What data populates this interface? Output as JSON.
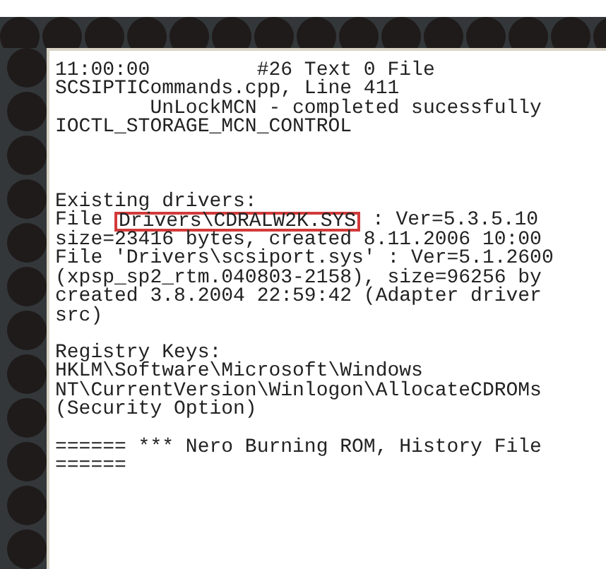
{
  "log": {
    "paragraphs": [
      {
        "lines": [
          {
            "kind": "plain",
            "text": "11:00:00         #26 Text 0 File"
          },
          {
            "kind": "plain",
            "text": "SCSIPTICommands.cpp, Line 411"
          },
          {
            "kind": "plain",
            "text": "        UnLockMCN - completed sucessfully"
          },
          {
            "kind": "plain",
            "text": "IOCTL_STORAGE_MCN_CONTROL"
          }
        ]
      },
      {
        "lines": [
          {
            "kind": "plain",
            "text": "Existing drivers:"
          },
          {
            "kind": "highlighted",
            "prefix": "File ",
            "highlight": "Drivers\\CDRALW2K.SYS",
            "suffix": " : Ver=5.3.5.10"
          },
          {
            "kind": "plain",
            "text": "size=23416 bytes, created 8.11.2006 10:00"
          },
          {
            "kind": "plain",
            "text": "File 'Drivers\\scsiport.sys' : Ver=5.1.2600"
          },
          {
            "kind": "plain",
            "text": "(xpsp_sp2_rtm.040803-2158), size=96256 by"
          },
          {
            "kind": "plain",
            "text": "created 3.8.2004 22:59:42 (Adapter driver"
          },
          {
            "kind": "plain",
            "text": "src)"
          }
        ]
      },
      {
        "lines": [
          {
            "kind": "plain",
            "text": "Registry Keys:"
          },
          {
            "kind": "plain",
            "text": "HKLM\\Software\\Microsoft\\Windows"
          },
          {
            "kind": "plain",
            "text": "NT\\CurrentVersion\\Winlogon\\AllocateCDROMs"
          },
          {
            "kind": "plain",
            "text": "(Security Option)"
          }
        ]
      },
      {
        "lines": [
          {
            "kind": "plain",
            "text": "====== *** Nero Burning ROM, History File"
          },
          {
            "kind": "plain",
            "text": "======"
          }
        ]
      }
    ]
  }
}
